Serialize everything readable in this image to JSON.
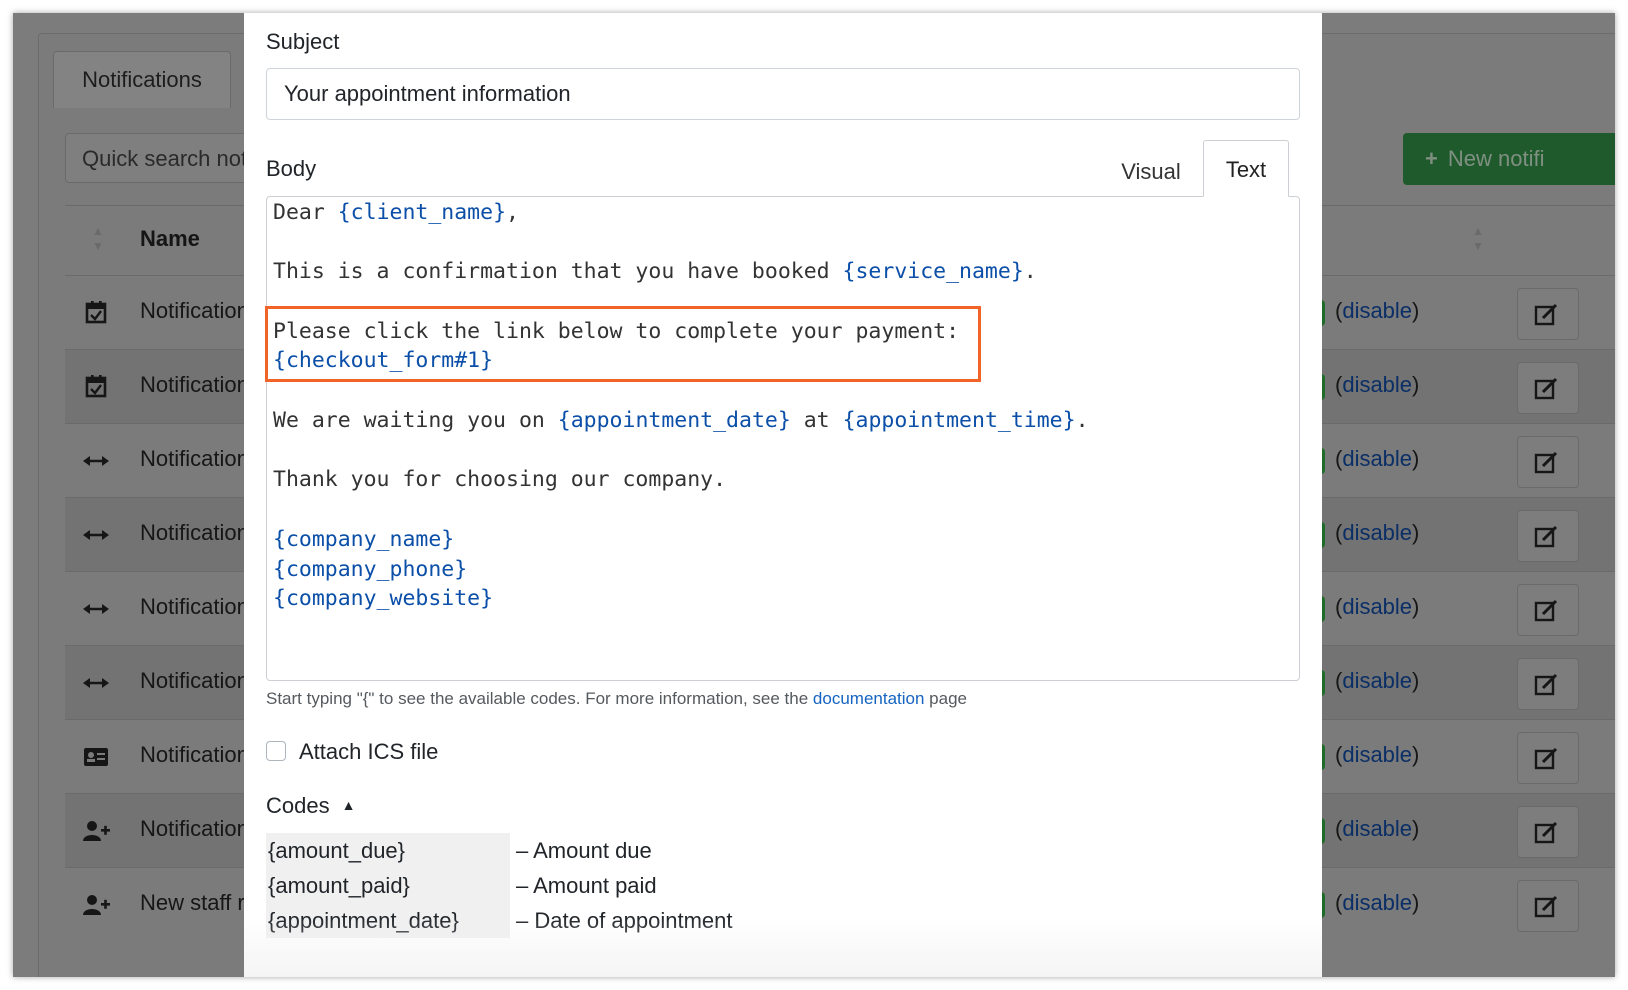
{
  "background": {
    "tab_label": "Notifications",
    "search_placeholder": "Quick search not",
    "new_button_label": "New notifi",
    "name_column": "Name",
    "rows": [
      {
        "name": "Notification",
        "icon": "calendar-check-icon",
        "disable": "disable"
      },
      {
        "name": "Notification",
        "icon": "calendar-check-icon",
        "disable": "disable"
      },
      {
        "name": "Notification",
        "icon": "arrows-horizontal-icon",
        "disable": "disable"
      },
      {
        "name": "Notification",
        "icon": "arrows-horizontal-icon",
        "disable": "disable"
      },
      {
        "name": "Notification",
        "icon": "arrows-horizontal-icon",
        "disable": "disable"
      },
      {
        "name": "Notification",
        "icon": "arrows-horizontal-icon",
        "disable": "disable"
      },
      {
        "name": "Notification",
        "icon": "id-card-icon",
        "disable": "disable"
      },
      {
        "name": "Notification",
        "icon": "user-plus-icon",
        "disable": "disable"
      },
      {
        "name": "New staff r",
        "icon": "user-plus-icon",
        "disable": "disable"
      }
    ]
  },
  "modal": {
    "subject_label": "Subject",
    "subject_value": "Your appointment information",
    "body_label": "Body",
    "tabs": {
      "visual": "Visual",
      "text": "Text"
    },
    "body_lines": {
      "l1_a": "Dear ",
      "l1_tok": "{client_name}",
      "l1_b": ",",
      "l3_a": "This is a confirmation that you have booked ",
      "l3_tok": "{service_name}",
      "l3_b": ".",
      "l5_a": "Please click the link below to complete your payment:",
      "l6_tok": "{checkout_form#1}",
      "l8_a": "We are waiting you on ",
      "l8_tok1": "{appointment_date}",
      "l8_b": " at ",
      "l8_tok2": "{appointment_time}",
      "l8_c": ".",
      "l10_a": "Thank you for choosing our company.",
      "l12_tok": "{company_name}",
      "l13_tok": "{company_phone}",
      "l14_tok": "{company_website}"
    },
    "help": {
      "before": "Start typing \"{\" to see the available codes. For more information, see the ",
      "link": "documentation",
      "after": " page"
    },
    "ics_label": "Attach ICS file",
    "ics_checked": false,
    "codes_label": "Codes",
    "codes": [
      {
        "key": "{amount_due}",
        "desc": "– Amount due"
      },
      {
        "key": "{amount_paid}",
        "desc": "– Amount paid"
      },
      {
        "key": "{appointment_date}",
        "desc": "– Date of appointment"
      }
    ]
  },
  "colors": {
    "highlight_border": "#f0642a",
    "code_token": "#0b4fa8",
    "link": "#1564c0",
    "overlay": "#7c7c7c"
  }
}
